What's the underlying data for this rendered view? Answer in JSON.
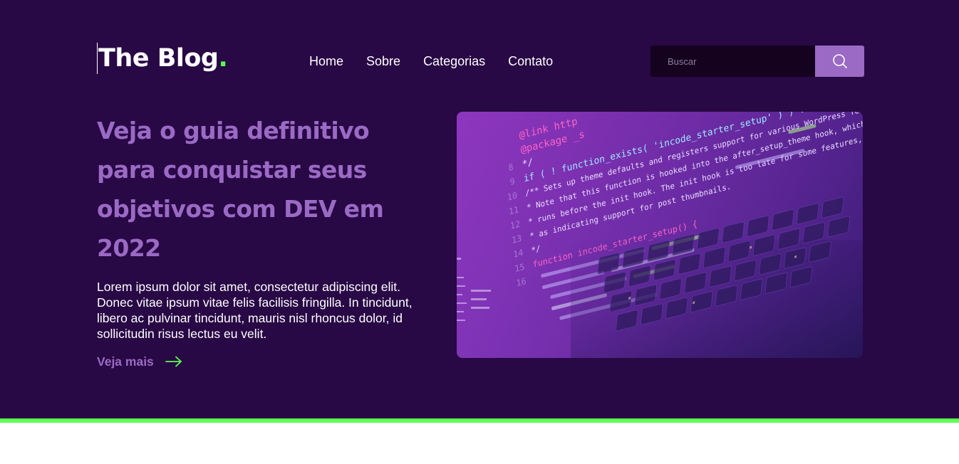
{
  "header": {
    "logo_text": "The Blog",
    "logo_dot": ".",
    "nav": [
      {
        "label": "Home"
      },
      {
        "label": "Sobre"
      },
      {
        "label": "Categorias"
      },
      {
        "label": "Contato"
      }
    ],
    "search": {
      "placeholder": "Buscar",
      "icon": "search-icon"
    }
  },
  "hero": {
    "headline": "Veja o guia definitivo para conquistar seus objetivos com DEV em 2022",
    "body": "Lorem ipsum dolor sit amet, consectetur adipiscing elit. Donec vitae ipsum vitae felis facilisis fringilla. In tincidunt, libero ac pulvinar tincidunt, mauris nisl rhoncus dolor, id sollicitudin risus lectus eu velit.",
    "cta_label": "Veja mais",
    "cta_icon": "arrow-right-icon",
    "image": {
      "subject": "laptop-code-photo",
      "code_lines": [
        "@link http",
        "@package _s",
        "*/",
        "if ( ! function_exists( 'incode_starter_setup' ) ) :",
        "/** Sets up theme defaults and registers support for various WordPress features.",
        " * Note that this function is hooked into the after_setup_theme hook, which",
        " * runs before the init hook. The init hook is too late for some features, such",
        " * as indicating support for post thumbnails.",
        " */",
        "function incode_starter_setup() {"
      ],
      "line_numbers": [
        "8",
        "9",
        "10",
        "11",
        "12",
        "13",
        "14",
        "15",
        "16"
      ]
    }
  },
  "colors": {
    "background": "#280845",
    "accent": "#9b6ac5",
    "highlight": "#5dff4f",
    "search_field": "#14021f",
    "text": "#ffffff"
  }
}
